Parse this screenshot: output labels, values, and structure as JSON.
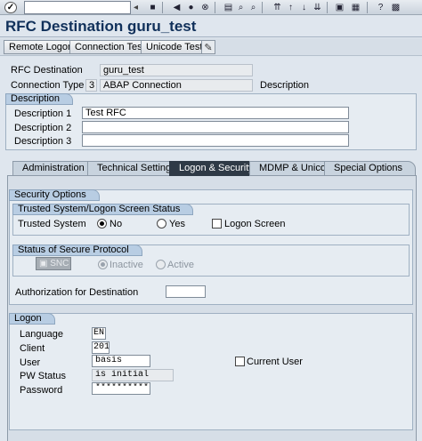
{
  "systoolbar": {
    "command_value": "",
    "icons": [
      "save-icon",
      "back-icon",
      "exit-icon",
      "cancel-icon",
      "print-icon",
      "find-icon",
      "find-next-icon",
      "first-page-icon",
      "prev-page-icon",
      "next-page-icon",
      "last-page-icon",
      "new-session-icon",
      "shortcut-icon",
      "help-icon",
      "layout-icon"
    ]
  },
  "title": "RFC Destination guru_test",
  "apptoolbar": {
    "remote_logon": "Remote Logon",
    "connection_test": "Connection Test",
    "unicode_test": "Unicode Test"
  },
  "header": {
    "rfc_destination_label": "RFC Destination",
    "rfc_destination_value": "guru_test",
    "connection_type_label": "Connection Type",
    "connection_type_code": "3",
    "connection_type_text": "ABAP Connection",
    "description_label": "Description"
  },
  "description": {
    "title": "Description",
    "desc1_label": "Description 1",
    "desc1_value": "Test RFC",
    "desc2_label": "Description 2",
    "desc2_value": "",
    "desc3_label": "Description 3",
    "desc3_value": ""
  },
  "tabs": [
    "Administration",
    "Technical Settings",
    "Logon & Security",
    "MDMP & Unicode",
    "Special Options"
  ],
  "security": {
    "title": "Security Options",
    "trusted_title": "Trusted System/Logon Screen Status",
    "trusted_label": "Trusted System",
    "no_label": "No",
    "yes_label": "Yes",
    "logon_screen_label": "Logon Screen",
    "secure_title": "Status of Secure Protocol",
    "snc_label": "SNC",
    "inactive_label": "Inactive",
    "active_label": "Active",
    "auth_label": "Authorization for Destination",
    "auth_value": ""
  },
  "logon": {
    "title": "Logon",
    "language_label": "Language",
    "language_value": "EN",
    "client_label": "Client",
    "client_value": "201",
    "user_label": "User",
    "user_value": "basis",
    "current_user_label": "Current User",
    "pw_status_label": "PW Status",
    "pw_status_value": "is initial",
    "password_label": "Password",
    "password_value": "************"
  },
  "colors": {
    "title": "#10305a",
    "active_tab": "#2f3a46",
    "group_header": "#b8cde3"
  }
}
